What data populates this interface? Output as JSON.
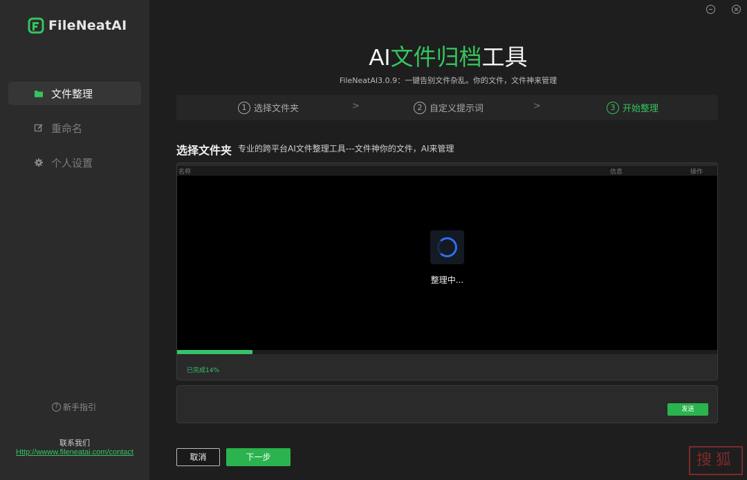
{
  "app": {
    "logo_text": "FileNeatAI",
    "title_prefix": "AI",
    "title_accent": "文件归档",
    "title_suffix": "工具",
    "subtitle": "FileNeatAI3.0.9：一键告别文件杂乱。你的文件，文件神来管理"
  },
  "sidebar": {
    "items": [
      {
        "label": "文件整理",
        "icon": "folder-icon",
        "active": true
      },
      {
        "label": "重命名",
        "icon": "edit-icon",
        "active": false
      },
      {
        "label": "个人设置",
        "icon": "gear-icon",
        "active": false
      }
    ],
    "guide_label": "新手指引",
    "contact_label": "联系我们",
    "contact_link": "Http://wwww.fileneatai.com/contact"
  },
  "steps": [
    {
      "num": "1",
      "label": "选择文件夹",
      "state": "default"
    },
    {
      "num": "2",
      "label": "自定义提示词",
      "state": "default"
    },
    {
      "num": "3",
      "label": "开始整理",
      "state": "done"
    }
  ],
  "step_separator": ">",
  "section": {
    "title": "选择文件夹",
    "description": "专业的跨平台AI文件整理工具---文件神你的文件，AI来管理"
  },
  "table": {
    "headers": [
      "名称",
      "信息",
      "操作"
    ]
  },
  "loading": {
    "text": "整理中..."
  },
  "progress": {
    "percent": 14,
    "label": "已完成14%"
  },
  "chat": {
    "send_label": "发送"
  },
  "footer": {
    "cancel_label": "取消",
    "next_label": "下一步"
  },
  "watermark_text": "搜狐",
  "colors": {
    "accent": "#35c45e",
    "button_green": "#2ab34e",
    "spinner": "#2f6ef0",
    "sidebar_bg": "#2b2b2b",
    "main_bg": "#1e1e1e"
  }
}
